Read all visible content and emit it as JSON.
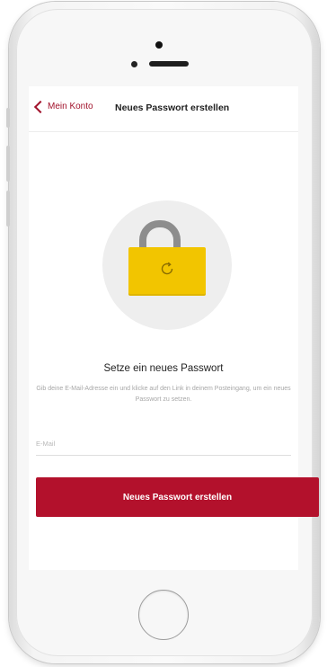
{
  "navbar": {
    "back_label": "Mein Konto",
    "title": "Neues Passwort erstellen"
  },
  "illustration": {
    "icon": "lock-refresh-icon",
    "lock_color": "#f2c500",
    "shackle_color": "#8d8d8d"
  },
  "content": {
    "heading": "Setze ein neues Passwort",
    "description": "Gib deine E-Mail-Adresse ein und klicke auf den Link in deinem Posteingang, um ein neues Passwort zu setzen."
  },
  "form": {
    "email_label": "E-Mail",
    "email_value": "",
    "submit_label": "Neues Passwort erstellen"
  },
  "colors": {
    "accent": "#b3112c",
    "back_link": "#a1122b"
  }
}
